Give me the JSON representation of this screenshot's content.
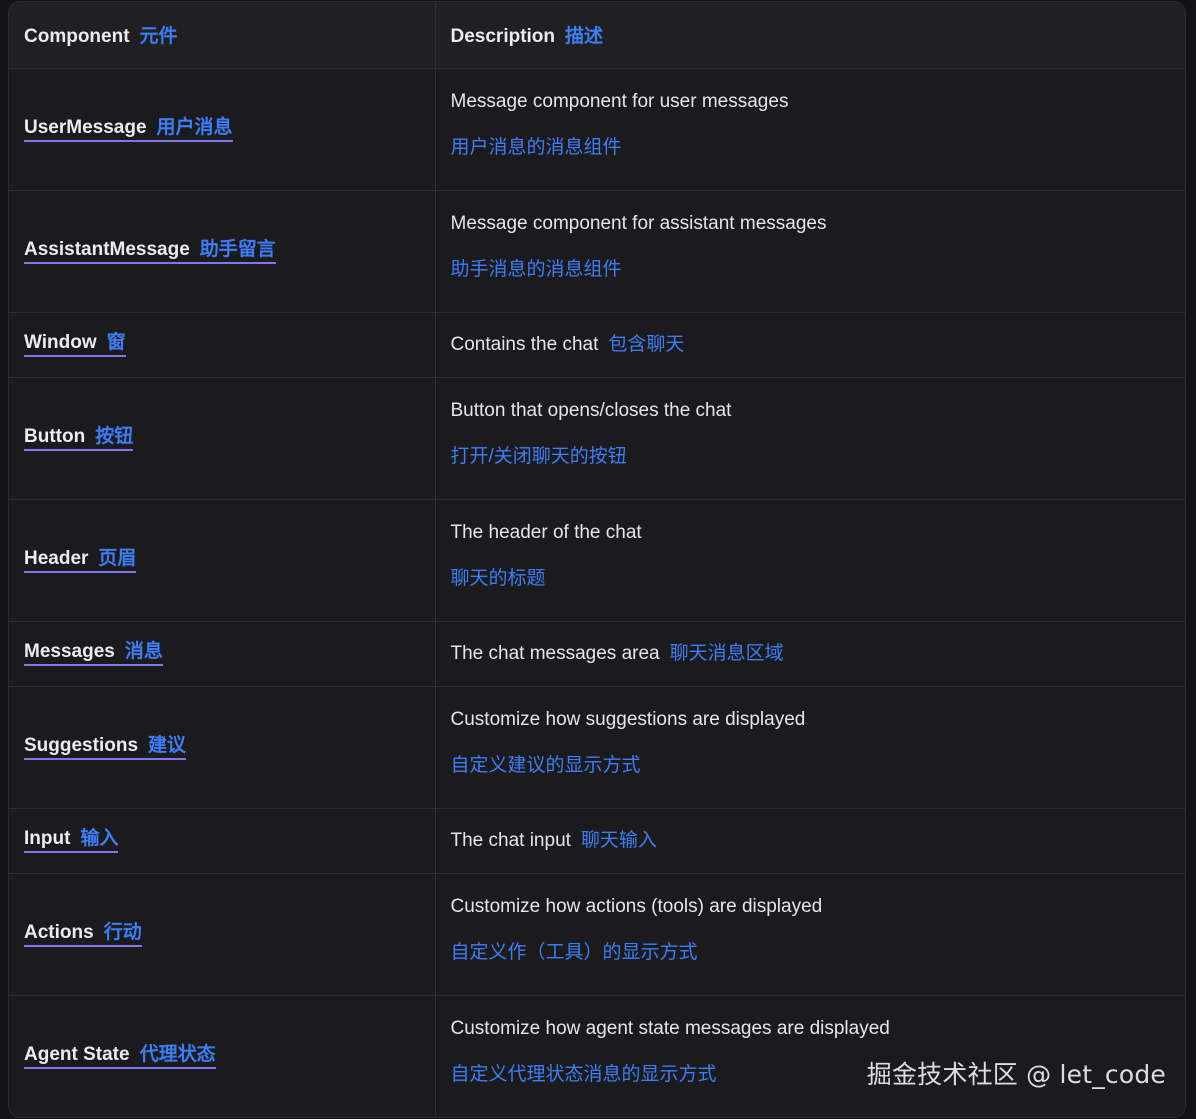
{
  "header": {
    "component_label": "Component",
    "component_zh": "元件",
    "description_label": "Description",
    "description_zh": "描述"
  },
  "rows": [
    {
      "name": "UserMessage",
      "name_zh": "用户消息",
      "desc": "Message component for user messages",
      "desc_zh": "用户消息的消息组件"
    },
    {
      "name": "AssistantMessage",
      "name_zh": "助手留言",
      "desc": "Message component for assistant messages",
      "desc_zh": "助手消息的消息组件"
    },
    {
      "name": "Window",
      "name_zh": "窗",
      "desc": "Contains the chat",
      "desc_zh": "包含聊天"
    },
    {
      "name": "Button",
      "name_zh": "按钮",
      "desc": "Button that opens/closes the chat",
      "desc_zh": "打开/关闭聊天的按钮"
    },
    {
      "name": "Header",
      "name_zh": "页眉",
      "desc": "The header of the chat",
      "desc_zh": "聊天的标题"
    },
    {
      "name": "Messages",
      "name_zh": "消息",
      "desc": "The chat messages area",
      "desc_zh": "聊天消息区域"
    },
    {
      "name": "Suggestions",
      "name_zh": "建议",
      "desc": "Customize how suggestions are displayed",
      "desc_zh": "自定义建议的显示方式"
    },
    {
      "name": "Input",
      "name_zh": "输入",
      "desc": "The chat input",
      "desc_zh": "聊天输入"
    },
    {
      "name": "Actions",
      "name_zh": "行动",
      "desc": "Customize how actions (tools) are displayed",
      "desc_zh": "自定义作（工具）的显示方式"
    },
    {
      "name": "Agent State",
      "name_zh": "代理状态",
      "desc": "Customize how agent state messages are displayed",
      "desc_zh": "自定义代理状态消息的显示方式"
    }
  ],
  "watermark": "掘金技术社区 @ let_code",
  "colors": {
    "background": "#1b1b1e",
    "header_bg": "#202023",
    "text": "#ececef",
    "accent_zh": "#3d7df5",
    "link_underline": "#8275f0",
    "border": "#2f2f33"
  }
}
